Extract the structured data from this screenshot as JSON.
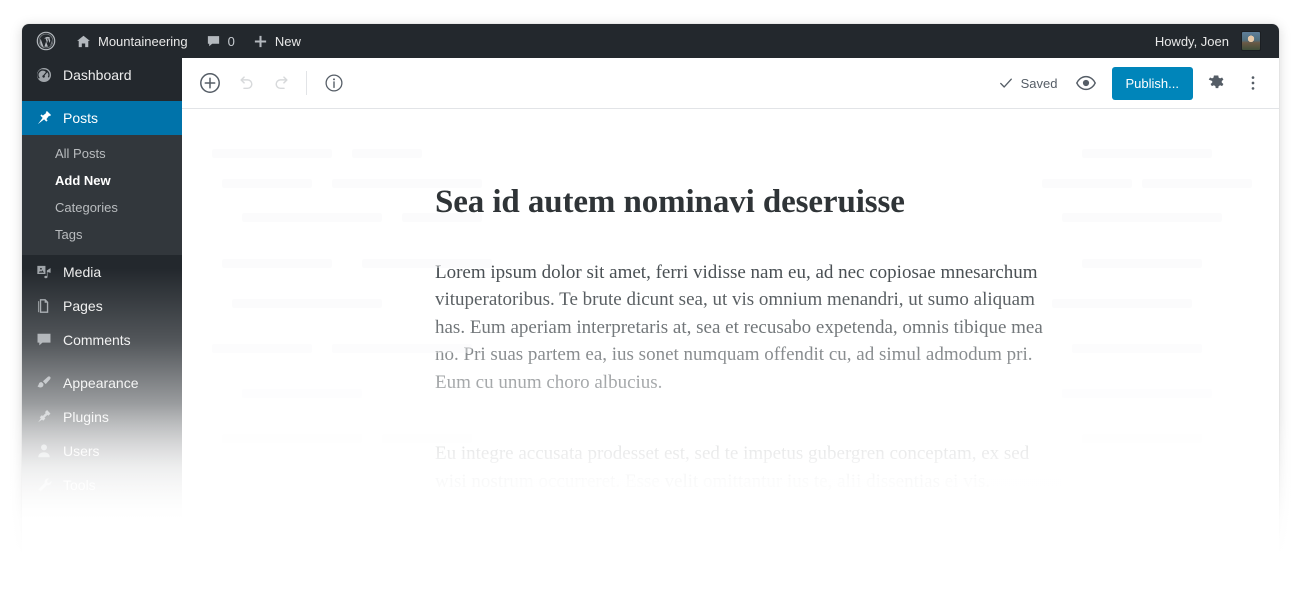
{
  "adminbar": {
    "wp_logo": "wordpress-logo",
    "site_name": "Mountaineering",
    "comments_count": "0",
    "new_label": "New",
    "howdy": "Howdy, Joen"
  },
  "sidebar": {
    "items": [
      {
        "label": "Dashboard",
        "icon": "dashboard-icon",
        "current": false
      },
      {
        "label": "Posts",
        "icon": "pin-icon",
        "current": true
      },
      {
        "label": "Media",
        "icon": "media-icon",
        "current": false
      },
      {
        "label": "Pages",
        "icon": "pages-icon",
        "current": false
      },
      {
        "label": "Comments",
        "icon": "comment-icon",
        "current": false
      },
      {
        "label": "Appearance",
        "icon": "brush-icon",
        "current": false
      },
      {
        "label": "Plugins",
        "icon": "plug-icon",
        "current": false
      },
      {
        "label": "Users",
        "icon": "users-icon",
        "current": false
      },
      {
        "label": "Tools",
        "icon": "tools-icon",
        "current": false
      }
    ],
    "posts_submenu": [
      {
        "label": "All Posts",
        "current": false
      },
      {
        "label": "Add New",
        "current": true
      },
      {
        "label": "Categories",
        "current": false
      },
      {
        "label": "Tags",
        "current": false
      }
    ]
  },
  "toolbar": {
    "add_block_label": "Add block",
    "undo_label": "Undo",
    "redo_label": "Redo",
    "info_label": "Content structure",
    "saved_label": "Saved",
    "preview_label": "Preview",
    "publish_label": "Publish...",
    "settings_label": "Settings",
    "more_label": "More options"
  },
  "post": {
    "title": "Sea id autem nominavi deseruisse",
    "paragraphs": [
      "Lorem ipsum dolor sit amet, ferri vidisse nam eu, ad nec copiosae mnesarchum vituperatoribus. Te brute dicunt sea, ut vis omnium menandri, ut sumo aliquam has. Eum aperiam interpretaris at, sea et recusabo expetenda, omnis tibique mea no. Pri suas partem ea, ius sonet numquam offendit cu, ad simul admodum pri. Eum cu unum choro albucius.",
      "Eu integre accusata prodesset est, sed te impetus gubergren conceptam, ex sed wisi nostrum occurreret. Esse velit omittantur ius te, alii dissentias ei vis."
    ]
  },
  "colors": {
    "adminbar_bg": "#23282d",
    "menu_bg": "#23282d",
    "submenu_bg": "#32373c",
    "menu_current": "#0073aa",
    "publish_bg": "#0085ba",
    "text_dark": "#2f3437"
  }
}
